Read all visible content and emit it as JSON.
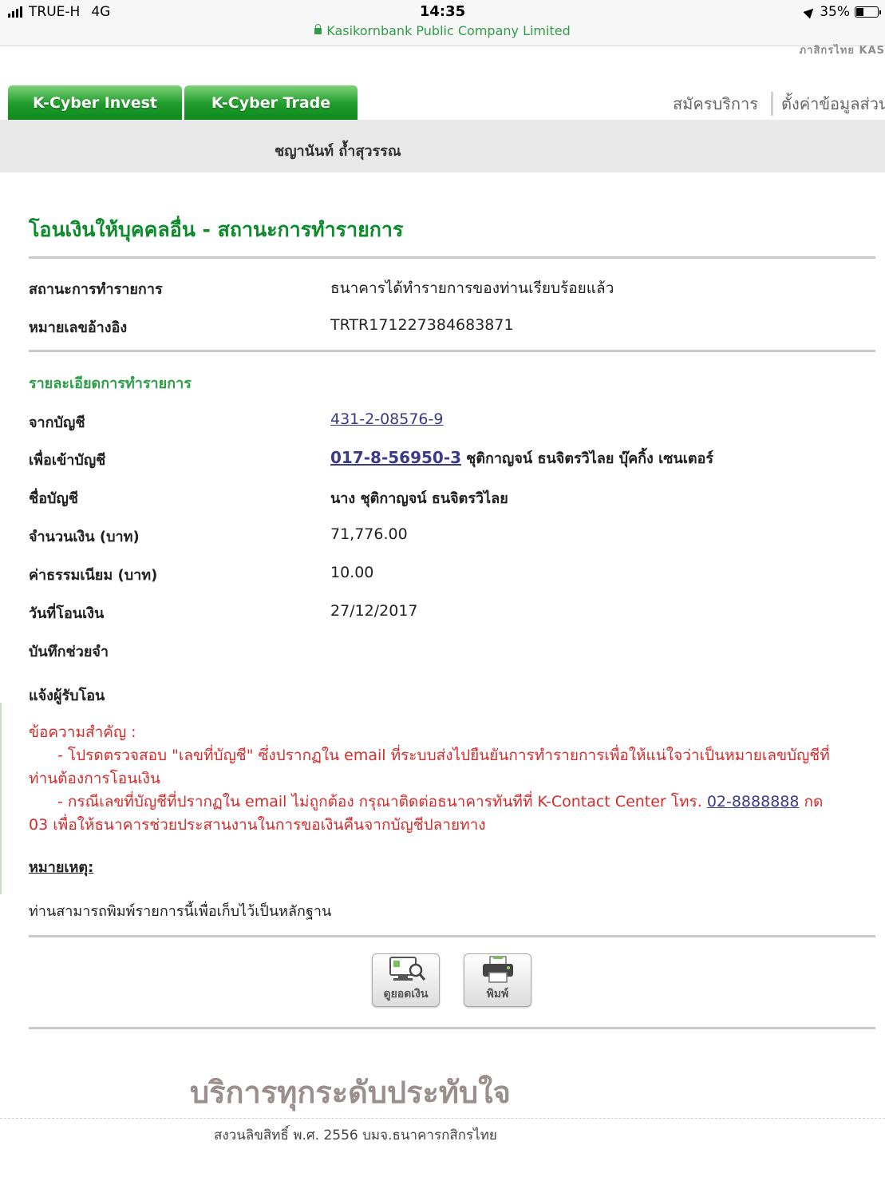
{
  "status_bar": {
    "carrier": "TRUE-H",
    "network": "4G",
    "time": "14:35",
    "url_title": "Kasikornbank Public Company Limited",
    "battery": "35%"
  },
  "header": {
    "brand_clipped": "ภาสิกรไทย KAS",
    "tabs": [
      "K-Cyber Invest",
      "K-Cyber Trade"
    ],
    "nav": [
      "สมัครบริการ",
      "ตั้งค่าข้อมูลส่วนตัว"
    ],
    "user_name": "ชญานันท์ ถ้ำสุวรรณ"
  },
  "page": {
    "title": "โอนเงินให้บุคคลอื่น - สถานะการทำรายการ",
    "status_label": "สถานะการทำรายการ",
    "status_value": "ธนาคารได้ทำรายการของท่านเรียบร้อยแล้ว",
    "ref_label": "หมายเลขอ้างอิง",
    "ref_value": "TRTR171227384683871",
    "section_title": "รายละเอียดการทำรายการ",
    "from_label": "จากบัญชี",
    "from_value": "431-2-08576-9",
    "to_label": "เพื่อเข้าบัญชี",
    "to_account": "017-8-56950-3",
    "to_name": "ชุติกาญจน์ ธนจิตรวิไลย บุ๊คกิ้ง เซนเตอร์",
    "account_name_label": "ชื่อบัญชี",
    "account_name_value": "นาง ชุติกาญจน์ ธนจิตรวิไลย",
    "amount_label": "จำนวนเงิน (บาท)",
    "amount_value": "71,776.00",
    "fee_label": "ค่าธรรมเนียม (บาท)",
    "fee_value": "10.00",
    "date_label": "วันที่โอนเงิน",
    "date_value": "27/12/2017",
    "memo_label": "บันทึกช่วยจำ",
    "notify_label": "แจ้งผู้รับโอน"
  },
  "notice": {
    "head": "ข้อความสำคัญ :",
    "line1": "- โปรดตรวจสอบ \"เลขที่บัญชี\" ซึ่งปรากฏใน email ที่ระบบส่งไปยืนยันการทำรายการเพื่อให้แน่ใจว่าเป็นหมายเลขบัญชีที่",
    "line1b": "ท่านต้องการโอนเงิน",
    "line2a": "- กรณีเลขที่บัญชีที่ปรากฏใน email ไม่ถูกต้อง กรุณาติดต่อธนาคารทันทีที่ K-Contact Center โทร.",
    "phone": "02-8888888",
    "line2b": "กด",
    "line3": "03 เพื่อให้ธนาคารช่วยประสานงานในการขอเงินคืนจากบัญชีปลายทาง"
  },
  "remark": {
    "head": "หมายเหตุ:",
    "text": "ท่านสามารถพิมพ์รายการนี้เพื่อเก็บไว้เป็นหลักฐาน"
  },
  "buttons": {
    "view_balance": "ดูยอดเงิน",
    "print": "พิมพ์"
  },
  "footer": {
    "slogan": "บริการทุกระดับประทับใจ",
    "copyright": "สงวนลิขสิทธิ์ พ.ศ. 2556 บมจ.ธนาคารกสิกรไทย"
  }
}
